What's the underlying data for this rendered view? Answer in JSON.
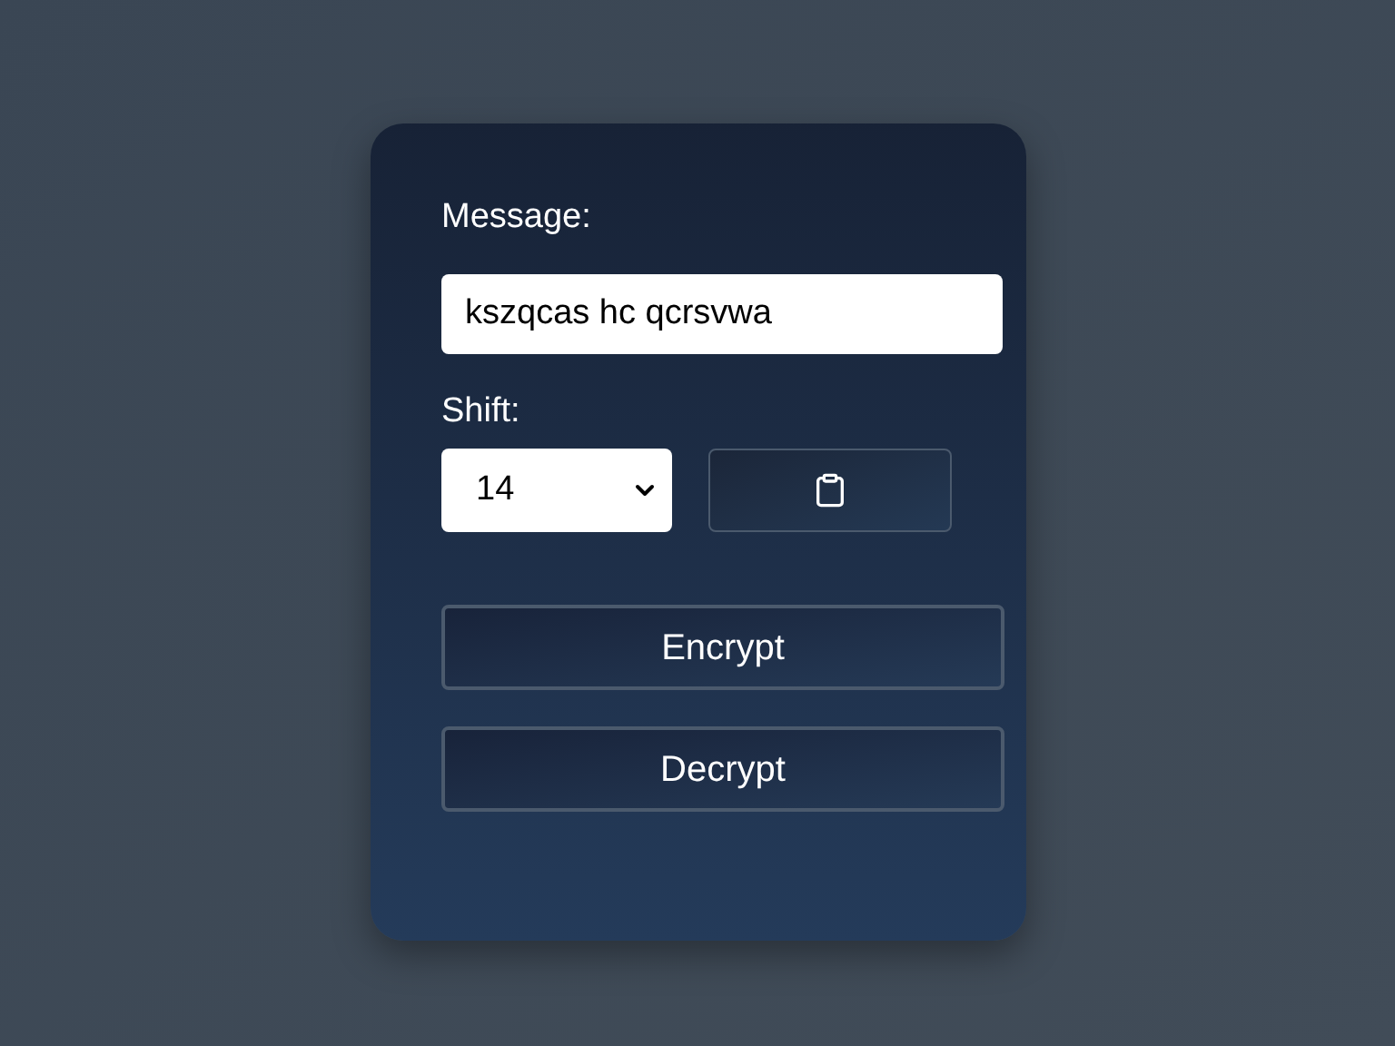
{
  "message": {
    "label": "Message:",
    "value": "kszqcas hc qcrsvwa"
  },
  "shift": {
    "label": "Shift:",
    "value": "14"
  },
  "buttons": [
    {
      "label": "Encrypt"
    },
    {
      "label": "Decrypt"
    }
  ]
}
